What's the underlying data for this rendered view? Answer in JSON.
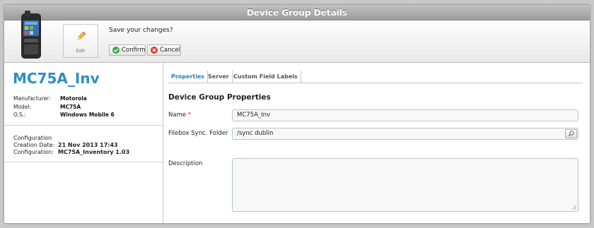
{
  "window": {
    "title": "Device Group Details"
  },
  "toolbar": {
    "edit_label": "Edit",
    "save_prompt": "Save your changes?",
    "confirm_label": "Confirm",
    "cancel_label": "Cancel"
  },
  "device": {
    "name": "MC75A_Inv",
    "info": [
      {
        "key": "Manufacturer:",
        "value": "Motorola"
      },
      {
        "key": "Model:",
        "value": "MC75A"
      },
      {
        "key": "O.S.:",
        "value": "Windows Mobile 6"
      }
    ],
    "configuration": {
      "title": "Configuration",
      "creation_key": "Creation Date:",
      "creation_value": "21 Nov 2013 17:43",
      "config_key": "Configuration:",
      "config_value": "MC75A_Inventory 1.03"
    }
  },
  "tabs": [
    {
      "label": "Properties",
      "active": true
    },
    {
      "label": "Server",
      "active": false
    },
    {
      "label": "Custom Field Labels",
      "active": false
    }
  ],
  "form": {
    "section_title": "Device Group Properties",
    "name_label": "Name",
    "required_mark": "*",
    "name_value": "MC75A_Inv",
    "filebox_label": "Filebox Sync. Folder",
    "filebox_value": "/sync dublin",
    "description_label": "Description",
    "description_value": ""
  },
  "colors": {
    "accent": "#2f8fbf",
    "tab_active": "#2f7fb4",
    "confirm_icon": "#3ea63e",
    "cancel_icon": "#d63b2b"
  },
  "icons": {
    "device": "handheld-device-icon",
    "edit": "pencil-icon",
    "confirm": "check-circle-icon",
    "cancel": "x-circle-icon",
    "browse": "search-icon"
  }
}
